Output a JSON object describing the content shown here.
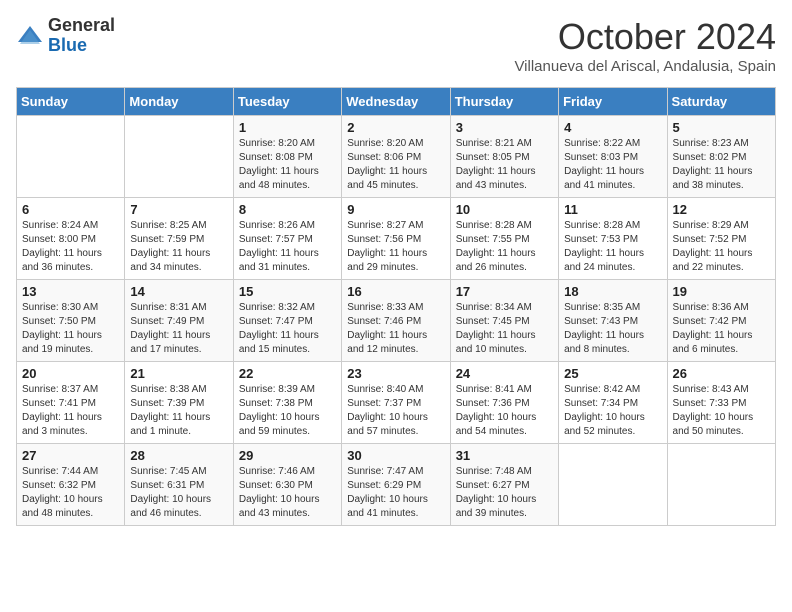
{
  "header": {
    "logo_general": "General",
    "logo_blue": "Blue",
    "month": "October 2024",
    "location": "Villanueva del Ariscal, Andalusia, Spain"
  },
  "days_of_week": [
    "Sunday",
    "Monday",
    "Tuesday",
    "Wednesday",
    "Thursday",
    "Friday",
    "Saturday"
  ],
  "weeks": [
    [
      {
        "day": "",
        "sunrise": "",
        "sunset": "",
        "daylight": ""
      },
      {
        "day": "",
        "sunrise": "",
        "sunset": "",
        "daylight": ""
      },
      {
        "day": "1",
        "sunrise": "Sunrise: 8:20 AM",
        "sunset": "Sunset: 8:08 PM",
        "daylight": "Daylight: 11 hours and 48 minutes."
      },
      {
        "day": "2",
        "sunrise": "Sunrise: 8:20 AM",
        "sunset": "Sunset: 8:06 PM",
        "daylight": "Daylight: 11 hours and 45 minutes."
      },
      {
        "day": "3",
        "sunrise": "Sunrise: 8:21 AM",
        "sunset": "Sunset: 8:05 PM",
        "daylight": "Daylight: 11 hours and 43 minutes."
      },
      {
        "day": "4",
        "sunrise": "Sunrise: 8:22 AM",
        "sunset": "Sunset: 8:03 PM",
        "daylight": "Daylight: 11 hours and 41 minutes."
      },
      {
        "day": "5",
        "sunrise": "Sunrise: 8:23 AM",
        "sunset": "Sunset: 8:02 PM",
        "daylight": "Daylight: 11 hours and 38 minutes."
      }
    ],
    [
      {
        "day": "6",
        "sunrise": "Sunrise: 8:24 AM",
        "sunset": "Sunset: 8:00 PM",
        "daylight": "Daylight: 11 hours and 36 minutes."
      },
      {
        "day": "7",
        "sunrise": "Sunrise: 8:25 AM",
        "sunset": "Sunset: 7:59 PM",
        "daylight": "Daylight: 11 hours and 34 minutes."
      },
      {
        "day": "8",
        "sunrise": "Sunrise: 8:26 AM",
        "sunset": "Sunset: 7:57 PM",
        "daylight": "Daylight: 11 hours and 31 minutes."
      },
      {
        "day": "9",
        "sunrise": "Sunrise: 8:27 AM",
        "sunset": "Sunset: 7:56 PM",
        "daylight": "Daylight: 11 hours and 29 minutes."
      },
      {
        "day": "10",
        "sunrise": "Sunrise: 8:28 AM",
        "sunset": "Sunset: 7:55 PM",
        "daylight": "Daylight: 11 hours and 26 minutes."
      },
      {
        "day": "11",
        "sunrise": "Sunrise: 8:28 AM",
        "sunset": "Sunset: 7:53 PM",
        "daylight": "Daylight: 11 hours and 24 minutes."
      },
      {
        "day": "12",
        "sunrise": "Sunrise: 8:29 AM",
        "sunset": "Sunset: 7:52 PM",
        "daylight": "Daylight: 11 hours and 22 minutes."
      }
    ],
    [
      {
        "day": "13",
        "sunrise": "Sunrise: 8:30 AM",
        "sunset": "Sunset: 7:50 PM",
        "daylight": "Daylight: 11 hours and 19 minutes."
      },
      {
        "day": "14",
        "sunrise": "Sunrise: 8:31 AM",
        "sunset": "Sunset: 7:49 PM",
        "daylight": "Daylight: 11 hours and 17 minutes."
      },
      {
        "day": "15",
        "sunrise": "Sunrise: 8:32 AM",
        "sunset": "Sunset: 7:47 PM",
        "daylight": "Daylight: 11 hours and 15 minutes."
      },
      {
        "day": "16",
        "sunrise": "Sunrise: 8:33 AM",
        "sunset": "Sunset: 7:46 PM",
        "daylight": "Daylight: 11 hours and 12 minutes."
      },
      {
        "day": "17",
        "sunrise": "Sunrise: 8:34 AM",
        "sunset": "Sunset: 7:45 PM",
        "daylight": "Daylight: 11 hours and 10 minutes."
      },
      {
        "day": "18",
        "sunrise": "Sunrise: 8:35 AM",
        "sunset": "Sunset: 7:43 PM",
        "daylight": "Daylight: 11 hours and 8 minutes."
      },
      {
        "day": "19",
        "sunrise": "Sunrise: 8:36 AM",
        "sunset": "Sunset: 7:42 PM",
        "daylight": "Daylight: 11 hours and 6 minutes."
      }
    ],
    [
      {
        "day": "20",
        "sunrise": "Sunrise: 8:37 AM",
        "sunset": "Sunset: 7:41 PM",
        "daylight": "Daylight: 11 hours and 3 minutes."
      },
      {
        "day": "21",
        "sunrise": "Sunrise: 8:38 AM",
        "sunset": "Sunset: 7:39 PM",
        "daylight": "Daylight: 11 hours and 1 minute."
      },
      {
        "day": "22",
        "sunrise": "Sunrise: 8:39 AM",
        "sunset": "Sunset: 7:38 PM",
        "daylight": "Daylight: 10 hours and 59 minutes."
      },
      {
        "day": "23",
        "sunrise": "Sunrise: 8:40 AM",
        "sunset": "Sunset: 7:37 PM",
        "daylight": "Daylight: 10 hours and 57 minutes."
      },
      {
        "day": "24",
        "sunrise": "Sunrise: 8:41 AM",
        "sunset": "Sunset: 7:36 PM",
        "daylight": "Daylight: 10 hours and 54 minutes."
      },
      {
        "day": "25",
        "sunrise": "Sunrise: 8:42 AM",
        "sunset": "Sunset: 7:34 PM",
        "daylight": "Daylight: 10 hours and 52 minutes."
      },
      {
        "day": "26",
        "sunrise": "Sunrise: 8:43 AM",
        "sunset": "Sunset: 7:33 PM",
        "daylight": "Daylight: 10 hours and 50 minutes."
      }
    ],
    [
      {
        "day": "27",
        "sunrise": "Sunrise: 7:44 AM",
        "sunset": "Sunset: 6:32 PM",
        "daylight": "Daylight: 10 hours and 48 minutes."
      },
      {
        "day": "28",
        "sunrise": "Sunrise: 7:45 AM",
        "sunset": "Sunset: 6:31 PM",
        "daylight": "Daylight: 10 hours and 46 minutes."
      },
      {
        "day": "29",
        "sunrise": "Sunrise: 7:46 AM",
        "sunset": "Sunset: 6:30 PM",
        "daylight": "Daylight: 10 hours and 43 minutes."
      },
      {
        "day": "30",
        "sunrise": "Sunrise: 7:47 AM",
        "sunset": "Sunset: 6:29 PM",
        "daylight": "Daylight: 10 hours and 41 minutes."
      },
      {
        "day": "31",
        "sunrise": "Sunrise: 7:48 AM",
        "sunset": "Sunset: 6:27 PM",
        "daylight": "Daylight: 10 hours and 39 minutes."
      },
      {
        "day": "",
        "sunrise": "",
        "sunset": "",
        "daylight": ""
      },
      {
        "day": "",
        "sunrise": "",
        "sunset": "",
        "daylight": ""
      }
    ]
  ]
}
